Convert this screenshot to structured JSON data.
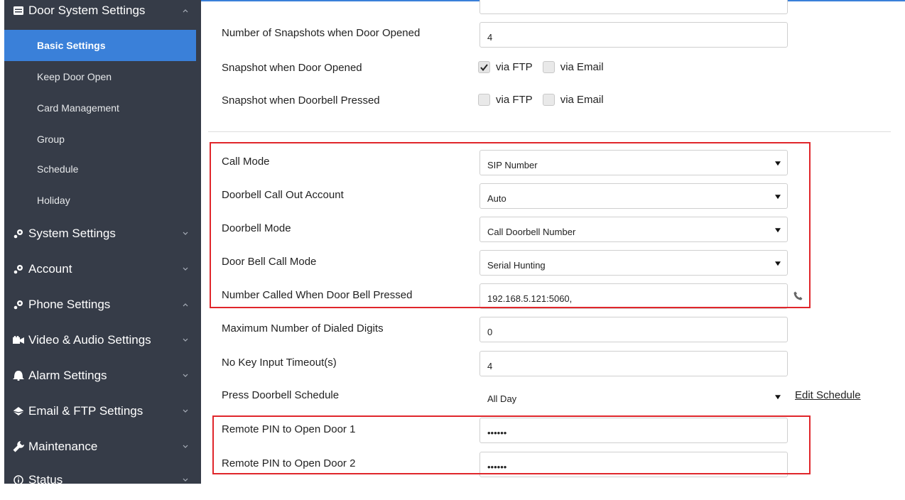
{
  "sidebar": {
    "door_system": {
      "label": "Door System Settings",
      "icon": "list-icon"
    },
    "sub_items": [
      {
        "label": "Basic Settings",
        "active": true
      },
      {
        "label": "Keep Door Open"
      },
      {
        "label": "Card Management"
      },
      {
        "label": "Group"
      },
      {
        "label": "Schedule"
      },
      {
        "label": "Holiday"
      }
    ],
    "sections": [
      {
        "label": "System Settings",
        "icon": "gear-dots-icon"
      },
      {
        "label": "Account",
        "icon": "gear-dots-icon"
      },
      {
        "label": "Phone Settings",
        "icon": "gear-dots-icon"
      },
      {
        "label": "Video & Audio Settings",
        "icon": "video-camera-icon"
      },
      {
        "label": "Alarm Settings",
        "icon": "alarm-icon"
      },
      {
        "label": "Email & FTP Settings",
        "icon": "email-icon"
      },
      {
        "label": "Maintenance",
        "icon": "wrench-icon"
      },
      {
        "label": "Status",
        "icon": "info-icon"
      }
    ]
  },
  "form": {
    "snapshots_count": {
      "label": "Number of Snapshots when Door Opened",
      "value": "4"
    },
    "snapshot_door_opened": {
      "label": "Snapshot when Door Opened",
      "ftp": "via FTP",
      "email": "via Email",
      "ftp_checked": true,
      "email_checked": false
    },
    "snapshot_doorbell": {
      "label": "Snapshot when Doorbell Pressed",
      "ftp": "via FTP",
      "email": "via Email",
      "ftp_checked": false,
      "email_checked": false
    },
    "call_mode": {
      "label": "Call Mode",
      "value": "SIP Number"
    },
    "doorbell_account": {
      "label": "Doorbell Call Out Account",
      "value": "Auto"
    },
    "doorbell_mode": {
      "label": "Doorbell Mode",
      "value": "Call Doorbell Number"
    },
    "door_bell_call_mode": {
      "label": "Door Bell Call Mode",
      "value": "Serial Hunting"
    },
    "number_called": {
      "label": "Number Called When Door Bell Pressed",
      "value": "192.168.5.121:5060,"
    },
    "max_digits": {
      "label": "Maximum Number of Dialed Digits",
      "value": "0"
    },
    "no_key_timeout": {
      "label": "No Key Input Timeout(s)",
      "value": "4"
    },
    "press_doorbell_schedule": {
      "label": "Press Doorbell Schedule",
      "value": "All Day",
      "link": "Edit Schedule"
    },
    "remote_pin_1": {
      "label": "Remote PIN to Open Door 1",
      "value": "••••••"
    },
    "remote_pin_2": {
      "label": "Remote PIN to Open Door 2",
      "value": "••••••"
    }
  },
  "colors": {
    "sidebar_bg": "#363c48",
    "active_bg": "#3a80d9",
    "highlight_box": "#e0262b"
  }
}
